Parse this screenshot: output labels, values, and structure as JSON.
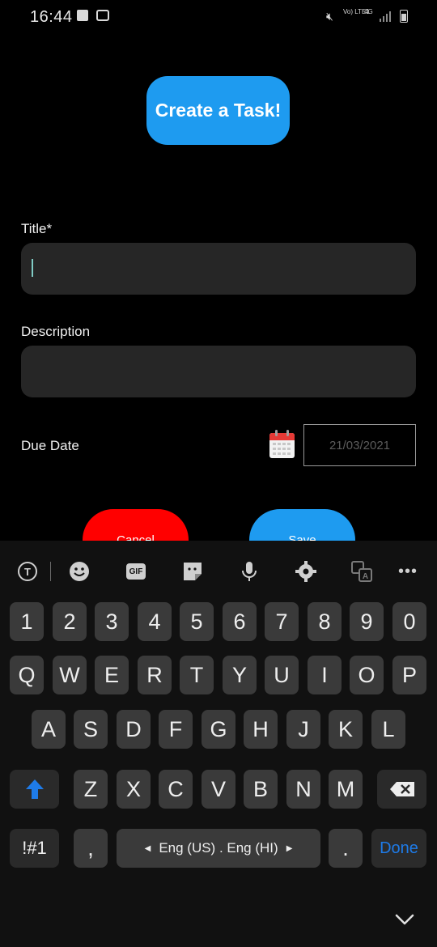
{
  "status_bar": {
    "time": "16:44",
    "volte": "Vo) LTE1",
    "network": "4G"
  },
  "header": {
    "button_label": "Create a Task!"
  },
  "form": {
    "title_label": "Title*",
    "title_value": "",
    "description_label": "Description",
    "description_value": "",
    "due_date_label": "Due Date",
    "due_date_value": "21/03/2021"
  },
  "actions": {
    "cancel_label": "Cancel",
    "save_label": "Save"
  },
  "keyboard": {
    "number_row": [
      "1",
      "2",
      "3",
      "4",
      "5",
      "6",
      "7",
      "8",
      "9",
      "0"
    ],
    "row_q": [
      "Q",
      "W",
      "E",
      "R",
      "T",
      "Y",
      "U",
      "I",
      "O",
      "P"
    ],
    "row_a": [
      "A",
      "S",
      "D",
      "F",
      "G",
      "H",
      "J",
      "K",
      "L"
    ],
    "row_z": [
      "Z",
      "X",
      "C",
      "V",
      "B",
      "N",
      "M"
    ],
    "symbols_label": "!#1",
    "comma": ",",
    "space_label": "Eng (US) . Eng (HI)",
    "period": ".",
    "done_label": "Done"
  },
  "colors": {
    "accent": "#1e9bf0",
    "cancel": "#ff0000",
    "field_bg": "#262626"
  }
}
